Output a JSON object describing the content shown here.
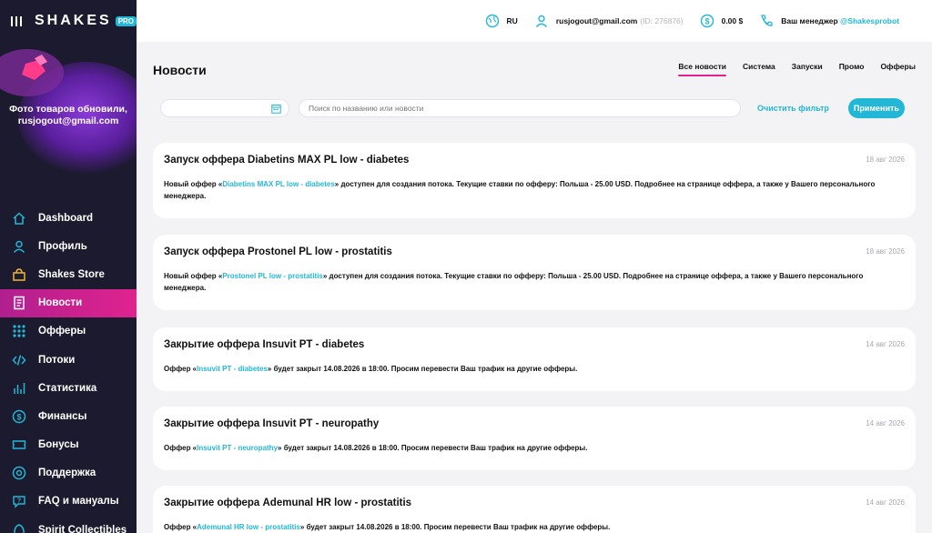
{
  "brand": {
    "name": "SHAKES",
    "badge": "PRO"
  },
  "promo": {
    "text": "Фото товаров обновили, rusjogout@gmail.com"
  },
  "sidebar": {
    "items": [
      {
        "label": "Dashboard",
        "icon": "home-icon"
      },
      {
        "label": "Профиль",
        "icon": "user-icon"
      },
      {
        "label": "Shakes Store",
        "icon": "bag-icon"
      },
      {
        "label": "Новости",
        "icon": "news-icon",
        "active": true
      },
      {
        "label": "Офферы",
        "icon": "grid-icon"
      },
      {
        "label": "Потоки",
        "icon": "code-icon"
      },
      {
        "label": "Статистика",
        "icon": "chart-icon"
      },
      {
        "label": "Финансы",
        "icon": "dollar-icon"
      },
      {
        "label": "Бонусы",
        "icon": "ticket-icon"
      },
      {
        "label": "Поддержка",
        "icon": "support-icon"
      },
      {
        "label": "FAQ и мануалы",
        "icon": "chat-icon"
      },
      {
        "label": "Spirit Collectibles",
        "icon": "spirit-icon"
      }
    ]
  },
  "topbar": {
    "lang": "RU",
    "email": "rusjogout@gmail.com",
    "user_id": "(ID: 276876)",
    "balance": "0.00 $",
    "manager_label": "Ваш менеджер",
    "manager_link": "@Shakesprobot"
  },
  "page": {
    "title": "Новости",
    "tabs": [
      "Все новости",
      "Система",
      "Запуски",
      "Промо",
      "Офферы"
    ]
  },
  "filter": {
    "search_placeholder": "Поиск по названию или новости",
    "clear_label": "Очистить фильтр",
    "apply_label": "Применить"
  },
  "news": [
    {
      "title": "Запуск оффера Diabetins MAX PL low - diabetes",
      "date": "18 авг 2026",
      "pre": "Новый оффер «",
      "link": "Diabetins MAX PL low - diabetes",
      "post": "» доступен для создания потока. Текущие ставки по офферу: Польша - 25.00 USD. Подробнее на странице оффера, а также у Вашего персонального менеджера."
    },
    {
      "title": "Запуск оффера Prostonel PL low - prostatitis",
      "date": "18 авг 2026",
      "pre": "Новый оффер «",
      "link": "Prostonel PL low - prostatitis",
      "post": "» доступен для создания потока. Текущие ставки по офферу: Польша - 25.00 USD. Подробнее на странице оффера, а также у Вашего персонального менеджера."
    },
    {
      "title": "Закрытие оффера Insuvit PT - diabetes",
      "date": "14 авг 2026",
      "pre": "Оффер «",
      "link": "Insuvit PT - diabetes",
      "post": "» будет закрыт 14.08.2026 в 18:00. Просим перевести Ваш трафик на другие офферы."
    },
    {
      "title": "Закрытие оффера Insuvit PT - neuropathy",
      "date": "14 авг 2026",
      "pre": "Оффер «",
      "link": "Insuvit PT - neuropathy",
      "post": "» будет закрыт 14.08.2026 в 18:00. Просим перевести Ваш трафик на другие офферы."
    },
    {
      "title": "Закрытие оффера Ademunal HR low - prostatitis",
      "date": "14 авг 2026",
      "pre": "Оффер «",
      "link": "Ademunal HR low - prostatitis",
      "post": "» будет закрыт 14.08.2026 в 18:00. Просим перевести Ваш трафик на другие офферы."
    }
  ],
  "colors": {
    "accent": "#22b7d6",
    "active": "#e0238e",
    "sidebar": "#1b1a2e"
  }
}
